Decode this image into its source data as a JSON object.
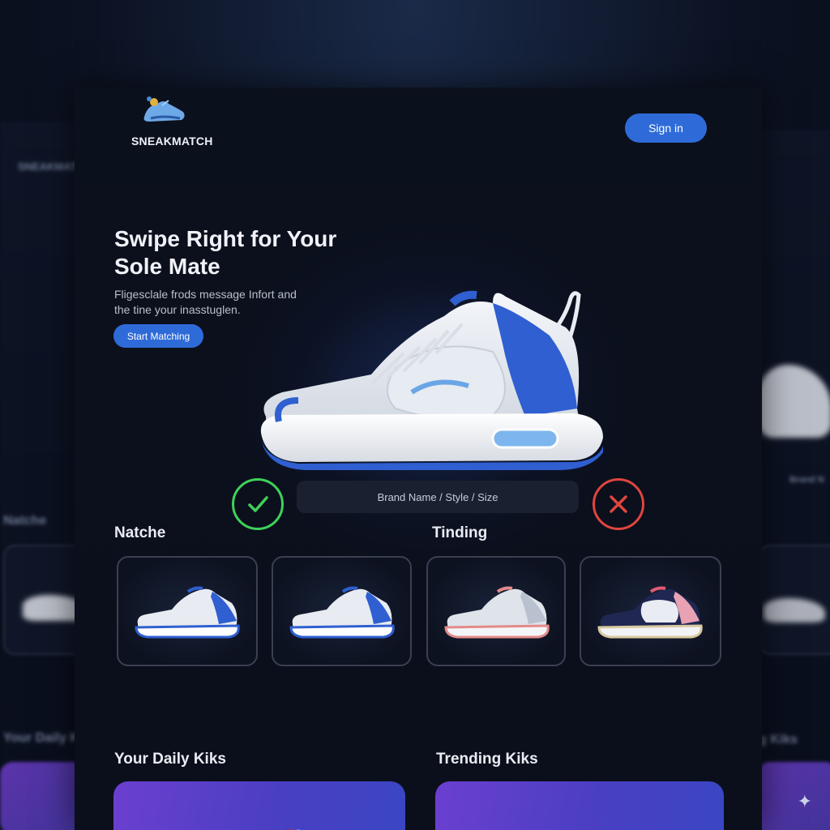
{
  "brand": {
    "name": "SNEAKMATCH"
  },
  "header": {
    "signin_label": "Sign in"
  },
  "hero": {
    "title": "Swipe Right for Your Sole Mate",
    "subtitle": "Fligesclale frods message Infort and the tine your inasstuglen.",
    "cta_label": "Start Matching"
  },
  "swipe": {
    "meta_text": "Brand Name / Style / Size",
    "like_icon": "check-icon",
    "dislike_icon": "x-icon"
  },
  "sections": {
    "matches_title": "Natche",
    "trending_title": "Tinding",
    "daily_title": "Your Daily Kiks",
    "trending_kiks_title": "Trending Kiks"
  },
  "background": {
    "left_logo": "SNEAKMATCH",
    "left_label_1": "Natche",
    "left_label_2": "Your Daily K",
    "right_label_1": "Brand N",
    "right_label_2": "g Kiks"
  },
  "colors": {
    "accent": "#2f6bd8",
    "like": "#3fd15a",
    "dislike": "#e0453f",
    "promo_start": "#6b3fd0",
    "promo_end": "#3a46c4"
  }
}
